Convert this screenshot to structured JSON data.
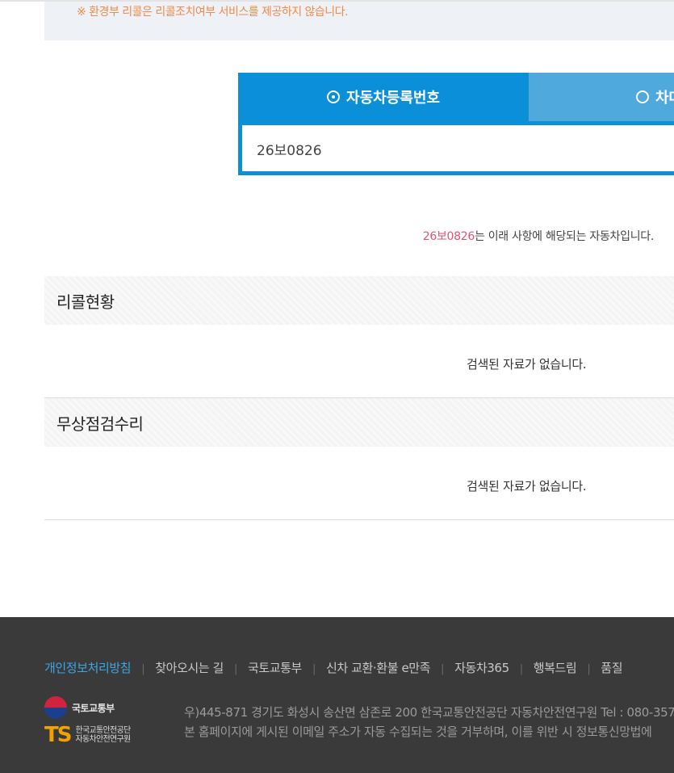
{
  "notice": {
    "text": "※ 환경부 리콜은 리콜조치여부 서비스를 제공하지 않습니다."
  },
  "search": {
    "tabs": [
      {
        "label": "자동차등록번호",
        "selected": true
      },
      {
        "label": "차대",
        "selected": false
      }
    ],
    "value": "26보0826"
  },
  "result": {
    "plate": "26보0826",
    "message": "는 이래 사항에 해당되는 자동차입니다."
  },
  "sections": [
    {
      "title": "리콜현황",
      "empty_text": "검색된 자료가 없습니다."
    },
    {
      "title": "무상점검수리",
      "empty_text": "검색된 자료가 없습니다."
    }
  ],
  "footer": {
    "links": [
      "개인정보처리방침",
      "찾아오시는 길",
      "국토교통부",
      "신차 교환·환불 e만족",
      "자동차365",
      "행복드림",
      "품질"
    ],
    "logo_molit": "국토교통부",
    "logo_ts_line1": "한국교통안전공단",
    "logo_ts_line2": "자동차안전연구원",
    "logo_ts_mark": "TS",
    "address": "우)445-871 경기도 화성시 송산면 삼존로 200 한국교통안전공단 자동차안전연구원 Tel : 080-357",
    "email_notice": "본 홈페이지에 게시된 이메일 주소가 자동 수집되는 것을 거부하며, 이를 위반 시 정보통신망법에"
  },
  "colors": {
    "tab_active": "#0a8fd8",
    "tab_inactive": "#4fa9dc",
    "notice_text": "#f08a4a",
    "plate_highlight": "#e0536f",
    "footer_bg": "#3a3a3a",
    "footer_link_active": "#3aa7e8"
  }
}
